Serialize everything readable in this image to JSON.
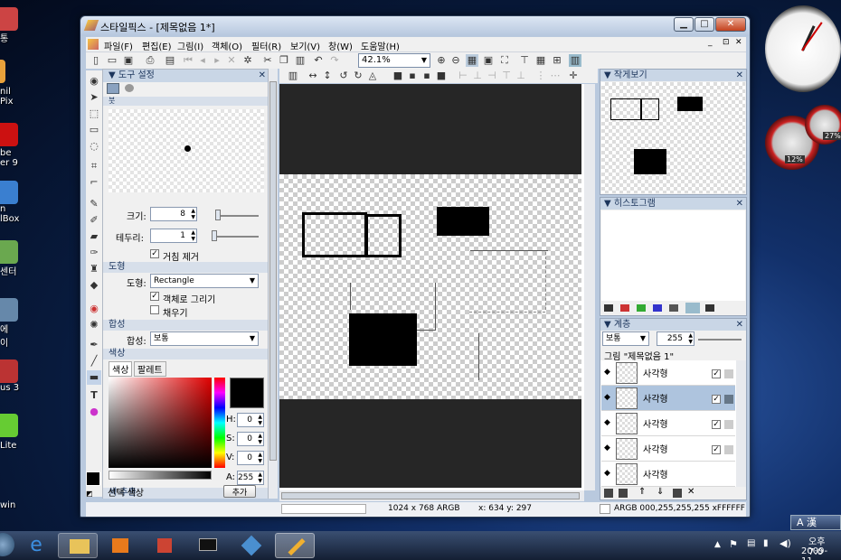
{
  "desktop": {
    "icons": [
      "통",
      "nil\nPix",
      "be\ner 9",
      "n\nlBox",
      "센터",
      "에\n이",
      "us 3",
      "Lite",
      "win"
    ],
    "gauge": {
      "cpu": "12%",
      "mem": "27%"
    }
  },
  "window": {
    "title": "스타일픽스 - [제목없음 1*]",
    "min": "▁",
    "max": "□",
    "close": "✕",
    "mdi": [
      "_",
      "⊡",
      "✕"
    ]
  },
  "menu": [
    "파일(F)",
    "편집(E)",
    "그림(I)",
    "객체(O)",
    "필터(R)",
    "보기(V)",
    "창(W)",
    "도움말(H)"
  ],
  "toolbar": {
    "zoom": "42.1%"
  },
  "tool_panel": {
    "title": "도구 설정",
    "brush_header": "붓",
    "size_label": "크기:",
    "size_value": "8",
    "border_label": "테두리:",
    "border_value": "1",
    "antialias": "거침 제거",
    "shape_header": "도형",
    "shape_label": "도형:",
    "shape_value": "Rectangle",
    "draw_object": "객체로 그리기",
    "fill": "채우기",
    "blend_header": "합성",
    "blend_label": "합성:",
    "blend_value": "보통",
    "color_header": "색상",
    "tab_color": "색상",
    "tab_palette": "팔레트",
    "h_label": "H:",
    "h_value": "0",
    "s_label": "S:",
    "s_value": "0",
    "v_label": "V:",
    "v_value": "0",
    "a_label": "A:",
    "a_value": "255",
    "extract_header": "색 추출",
    "select_color": "선택 색상",
    "add_button": "추가"
  },
  "navigator": {
    "title": "작게보기"
  },
  "histogram": {
    "title": "히스토그램"
  },
  "layers": {
    "title": "계층",
    "blend": "보통",
    "opacity": "255",
    "group": "그림 \"제목없음 1\"",
    "items": [
      "사각형",
      "사각형",
      "사각형",
      "사각형",
      "사각형"
    ]
  },
  "status": {
    "size": "1024 x 768 ARGB",
    "coords": "x: 634 y: 297",
    "color": "ARGB 000,255,255,255 xFFFFFF"
  },
  "taskbar": {
    "ime": "A 漢",
    "time": "오후 7:0",
    "date": "2009-11-"
  }
}
